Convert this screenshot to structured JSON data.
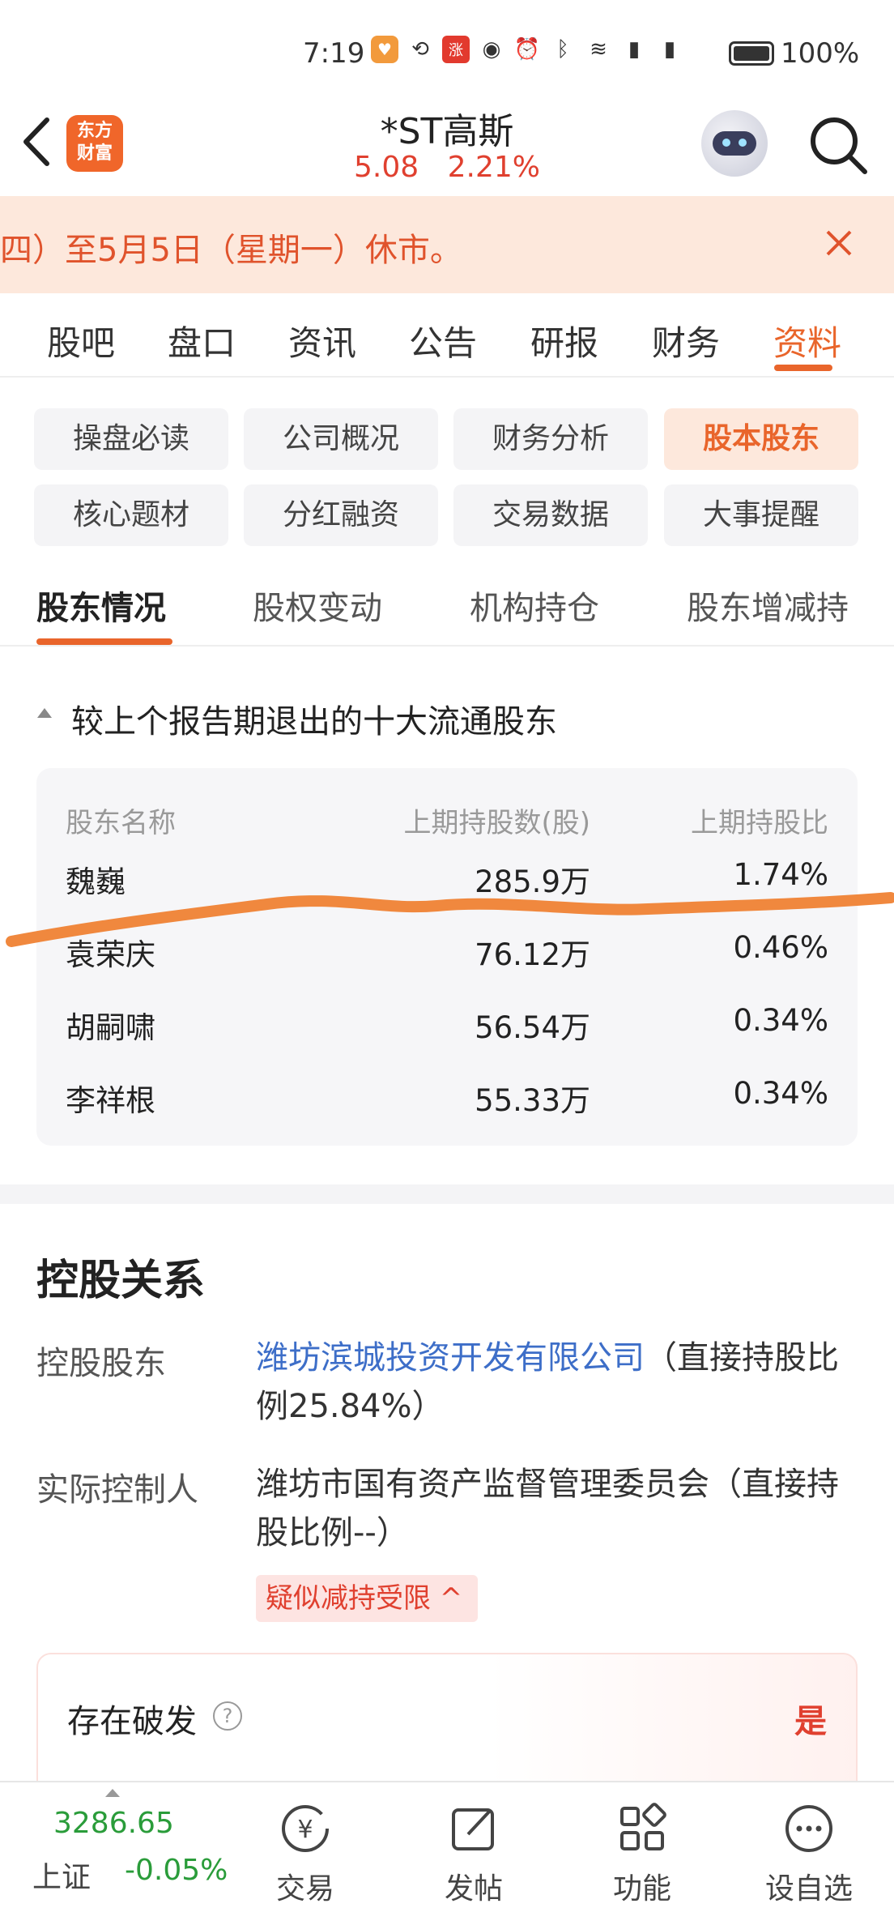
{
  "status_bar": {
    "time": "7:19",
    "battery": "100%"
  },
  "header": {
    "logo_text": "东方\n财富",
    "stock_name": "*ST高斯",
    "price": "5.08",
    "change_pct": "2.21%"
  },
  "notice": {
    "text": "四）至5月5日（星期一）休市。"
  },
  "main_tabs": [
    "股吧",
    "盘口",
    "资讯",
    "公告",
    "研报",
    "财务",
    "资料"
  ],
  "main_tabs_active": "资料",
  "chips": [
    "操盘必读",
    "公司概况",
    "财务分析",
    "股本股东",
    "核心题材",
    "分红融资",
    "交易数据",
    "大事提醒"
  ],
  "chips_active": "股本股东",
  "sub_tabs": [
    "股东情况",
    "股权变动",
    "机构持仓",
    "股东增减持"
  ],
  "sub_tabs_active": "股东情况",
  "exited": {
    "title": "较上个报告期退出的十大流通股东",
    "headers": [
      "股东名称",
      "上期持股数(股)",
      "上期持股比"
    ],
    "rows": [
      {
        "name": "魏巍",
        "shares": "285.9万",
        "ratio": "1.74%"
      },
      {
        "name": "袁荣庆",
        "shares": "76.12万",
        "ratio": "0.46%"
      },
      {
        "name": "胡嗣啸",
        "shares": "56.54万",
        "ratio": "0.34%"
      },
      {
        "name": "李祥根",
        "shares": "55.33万",
        "ratio": "0.34%"
      }
    ]
  },
  "holding": {
    "title": "控股关系",
    "controlling_label": "控股股东",
    "controlling_link": "潍坊滨城投资开发有限公司",
    "controlling_note": "（直接持股比例25.84%）",
    "actual_label": "实际控制人",
    "actual_value": "潍坊市国有资产监督管理委员会（直接持股比例--）",
    "risk_tag": "疑似减持受限 ^",
    "risk_card_label": "存在破发",
    "risk_card_value": "是"
  },
  "bottom_nav": {
    "index_value": "3286.65",
    "index_name": "上证",
    "index_change": "-0.05%",
    "items": [
      "交易",
      "发帖",
      "功能",
      "设自选"
    ]
  },
  "colors": {
    "accent": "#e9652b",
    "red": "#e0402f",
    "green": "#2a9c3a",
    "link": "#3d6ec8"
  }
}
